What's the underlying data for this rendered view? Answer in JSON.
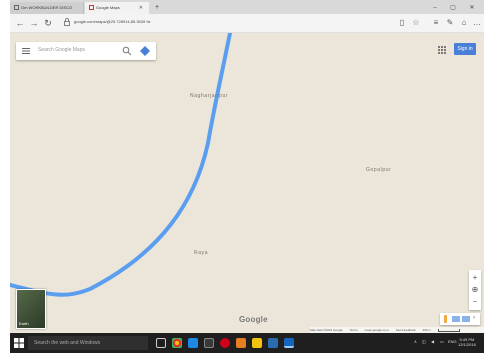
{
  "browser": {
    "tabs": [
      {
        "label": "Gm WORKBUILDER DISCO"
      },
      {
        "label": "Google Maps"
      }
    ],
    "new_tab_label": "+",
    "url": "google.com/maps/@25.728914,85.3539 9z",
    "window_controls": [
      "–",
      "▢",
      "✕"
    ]
  },
  "map": {
    "search_placeholder": "Search Google Maps",
    "sign_in_label": "Sign in",
    "places": [
      {
        "name": "Nagharjaripur"
      },
      {
        "name": "Gopalpur"
      },
      {
        "name": "Raya"
      }
    ],
    "satellite_label": "Earth",
    "logo": "Google",
    "zoom_in": "+",
    "zoom_out": "−",
    "footer": [
      "Map data ©2016 Google",
      "Terms",
      "maps.google.co.in",
      "Send feedback",
      "200 m"
    ]
  },
  "taskbar": {
    "search_placeholder": "Search the web and Windows",
    "clock_time": "5:49 PM",
    "clock_date": "12/1/2016",
    "language": "ENG"
  },
  "colors": {
    "map_land": "#ebe6d9",
    "route": "#5b9ef0",
    "sign_in": "#4a7fd8",
    "taskbar": "#1f1f1f"
  }
}
